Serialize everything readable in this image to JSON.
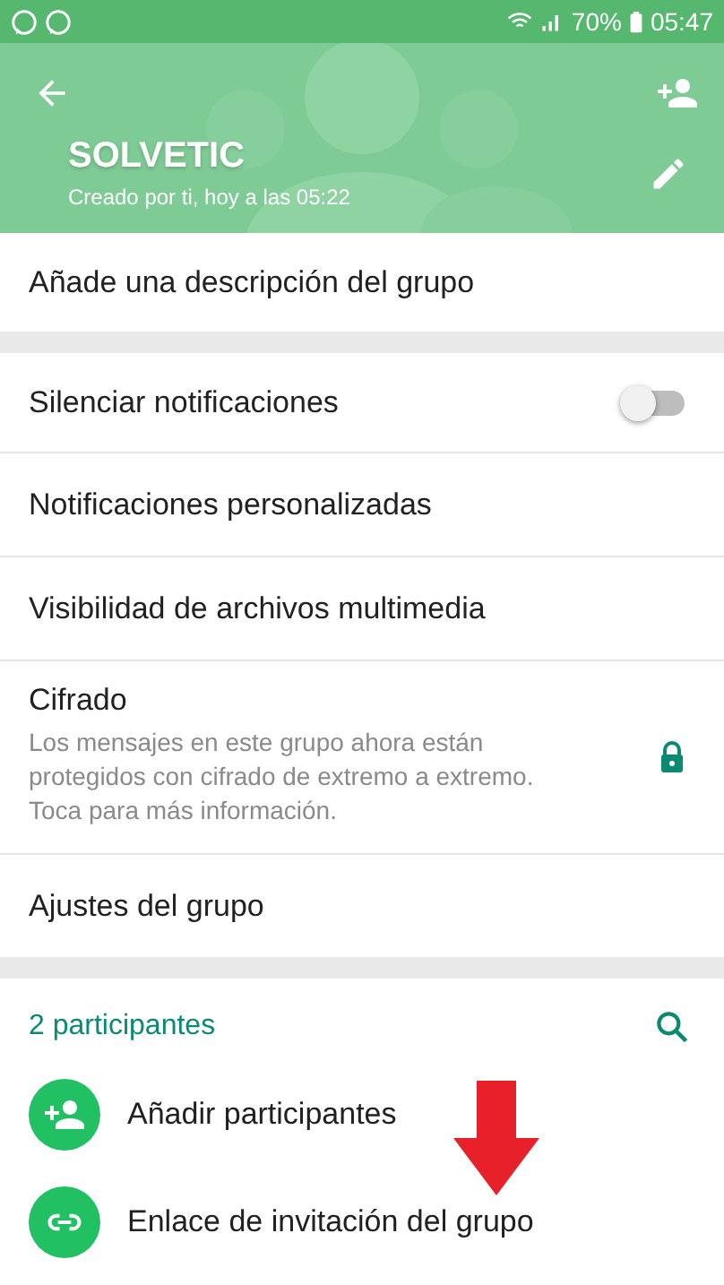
{
  "status_bar": {
    "battery": "70%",
    "time": "05:47"
  },
  "header": {
    "title": "SOLVETIC",
    "subtitle": "Creado por ti, hoy a las 05:22"
  },
  "description": {
    "label": "Añade una descripción del grupo"
  },
  "settings": [
    {
      "kind": "toggle",
      "label": "Silenciar notificaciones",
      "on": false
    },
    {
      "kind": "plain",
      "label": "Notificaciones personalizadas"
    },
    {
      "kind": "plain",
      "label": "Visibilidad de archivos multimedia"
    },
    {
      "kind": "lock",
      "label": "Cifrado",
      "detail": "Los mensajes en este grupo ahora están protegidos con cifrado de extremo a extremo. Toca para más información."
    },
    {
      "kind": "plain",
      "label": "Ajustes del grupo"
    }
  ],
  "participants": {
    "heading": "2 participantes",
    "actions": [
      {
        "kind": "add",
        "label": "Añadir participantes"
      },
      {
        "kind": "link",
        "label": "Enlace de invitación del grupo"
      }
    ]
  }
}
